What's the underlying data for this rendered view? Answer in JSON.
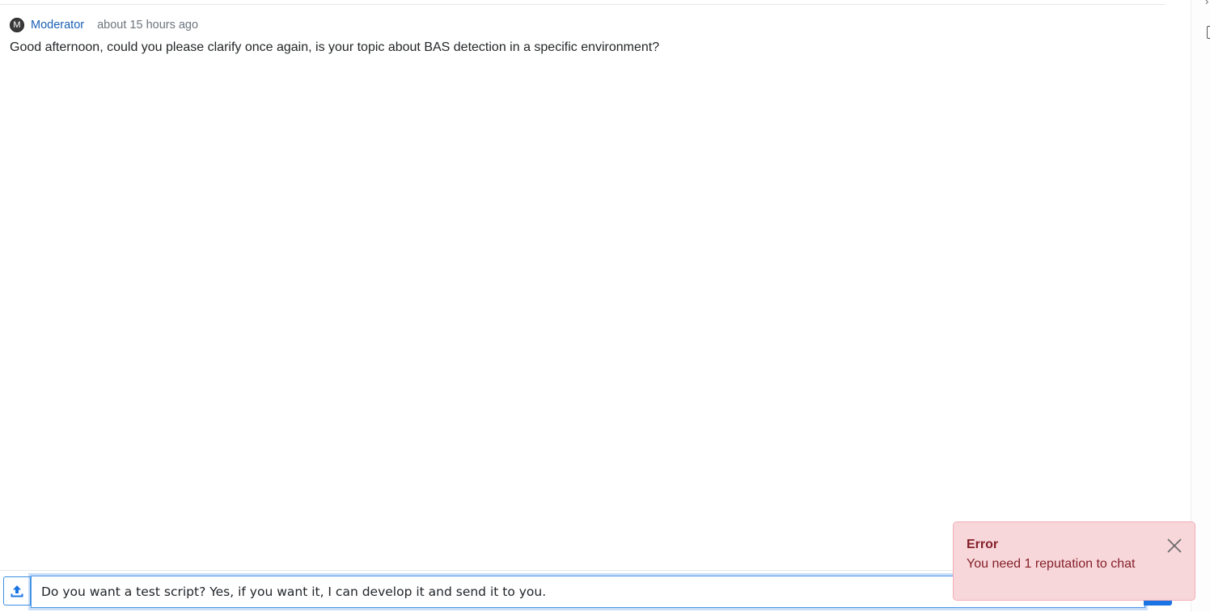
{
  "message": {
    "avatar_initial": "M",
    "username": "Moderator",
    "timestamp": "about 15 hours ago",
    "text": "Good afternoon, could you please clarify once again, is your topic about BAS detection in a specific environment?"
  },
  "composer": {
    "input_value": "Do you want a test script? Yes, if you want it, I can develop it and send it to you. ",
    "upload_icon": "upload-icon",
    "send_icon": "send-icon"
  },
  "toast": {
    "title": "Error",
    "message": "You need 1 reputation to chat",
    "close_icon": "close-icon"
  },
  "colors": {
    "link": "#1a5fb4",
    "muted": "#6c757d",
    "accent": "#1b74e4",
    "error_bg": "#f8d7da",
    "error_text": "#842029"
  }
}
